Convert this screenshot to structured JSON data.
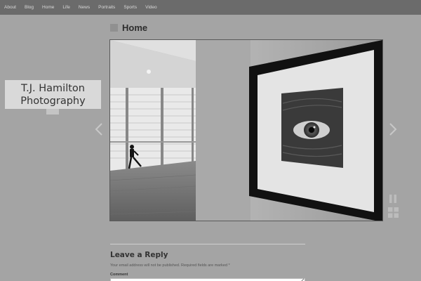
{
  "nav": {
    "items": [
      {
        "label": "About"
      },
      {
        "label": "Blog"
      },
      {
        "label": "Home"
      },
      {
        "label": "Life"
      },
      {
        "label": "News"
      },
      {
        "label": "Portraits"
      },
      {
        "label": "Sports"
      },
      {
        "label": "Video"
      }
    ]
  },
  "site": {
    "title_line1": "T.J. Hamilton",
    "title_line2": "Photography"
  },
  "page": {
    "title": "Home"
  },
  "reply": {
    "heading": "Leave a Reply",
    "note": "Your email address will not be published. Required fields are marked *",
    "comment_label": "Comment"
  },
  "icons": {
    "prev": "chevron-left-icon",
    "next": "chevron-right-icon",
    "pause": "pause-icon",
    "grid": "grid-icon"
  },
  "colors": {
    "nav_bg": "#6b6b6b",
    "page_bg": "#a4a4a4",
    "logo_bg": "#d9d9d9"
  }
}
